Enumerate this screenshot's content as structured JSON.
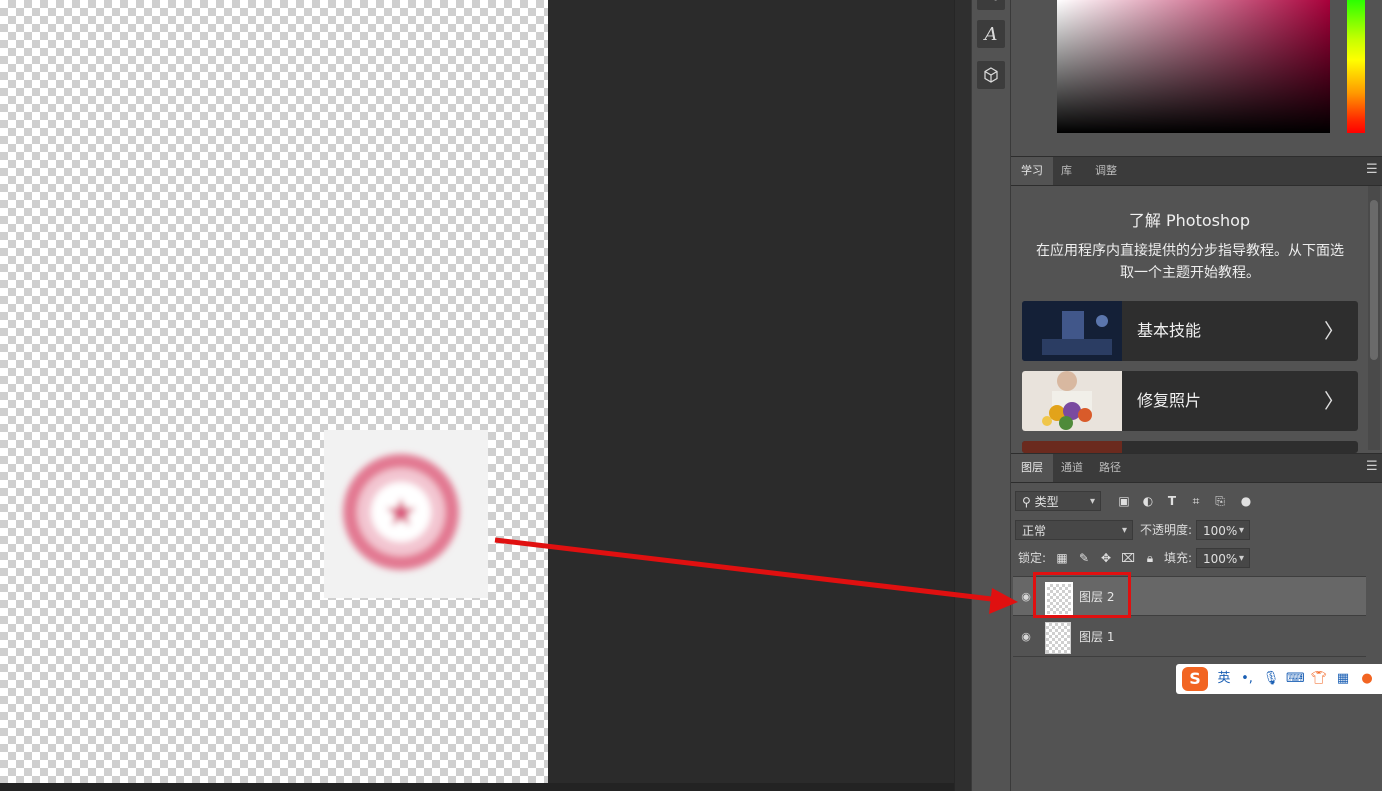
{
  "learn_panel": {
    "tabs": [
      "学习",
      "库",
      "调整"
    ],
    "title": "了解 Photoshop",
    "description": "在应用程序内直接提供的分步指导教程。从下面选取一个主题开始教程。",
    "cards": [
      {
        "label": "基本技能"
      },
      {
        "label": "修复照片"
      }
    ]
  },
  "layers_panel": {
    "tabs": [
      "图层",
      "通道",
      "路径"
    ],
    "filter_kind": "类型",
    "blend_mode": "正常",
    "opacity_label": "不透明度:",
    "opacity_value": "100%",
    "lock_label": "锁定:",
    "fill_label": "填充:",
    "fill_value": "100%",
    "layers": [
      {
        "name": "图层 2",
        "selected": true
      },
      {
        "name": "图层 1",
        "selected": false
      }
    ]
  },
  "ime_bar": {
    "logo": "S",
    "mode": "英",
    "punct": "•,"
  },
  "colors": {
    "stamp": "#e0607c",
    "highlight": "#e01010",
    "panel_bg": "#535353"
  }
}
